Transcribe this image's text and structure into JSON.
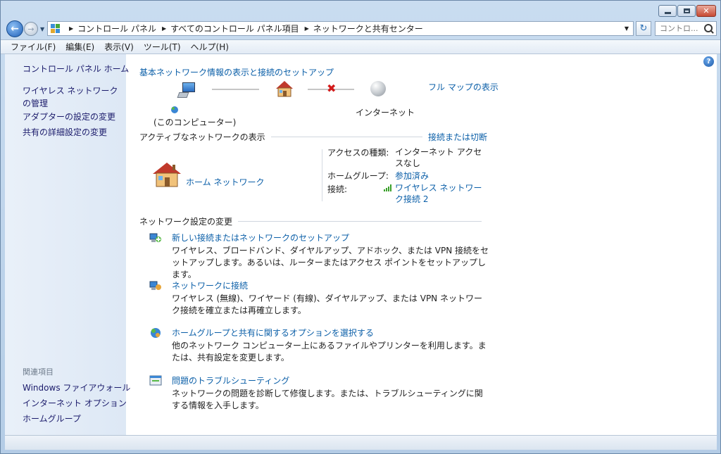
{
  "window": {
    "minimize_glyph": "",
    "close_glyph": "✕"
  },
  "address": {
    "crumbs": [
      "コントロール パネル",
      "すべてのコントロール パネル項目",
      "ネットワークと共有センター"
    ],
    "search_placeholder": "コントロ..."
  },
  "menu": [
    "ファイル(F)",
    "編集(E)",
    "表示(V)",
    "ツール(T)",
    "ヘルプ(H)"
  ],
  "sidebar": {
    "home": "コントロール パネル ホーム",
    "links": [
      "ワイヤレス ネットワークの管理",
      "アダプターの設定の変更",
      "共有の詳細設定の変更"
    ],
    "related_title": "関連項目",
    "related": [
      "Windows ファイアウォール",
      "インターネット オプション",
      "ホームグループ"
    ]
  },
  "main": {
    "title": "基本ネットワーク情報の表示と接続のセットアップ",
    "full_map": "フル マップの表示",
    "pc_label": "(このコンピューター)",
    "internet_label": "インターネット",
    "active_title": "アクティブなネットワークの表示",
    "connect_disconnect": "接続または切断",
    "network_name": "ホーム ネットワーク",
    "access_type_label": "アクセスの種類:",
    "access_type_value": "インターネット アクセスなし",
    "homegroup_label": "ホームグループ:",
    "homegroup_value": "参加済み",
    "connection_label": "接続:",
    "connection_value": "ワイヤレス ネットワーク接続 2",
    "settings_title": "ネットワーク設定の変更",
    "tasks": [
      {
        "link": "新しい接続またはネットワークのセットアップ",
        "desc": "ワイヤレス、ブロードバンド、ダイヤルアップ、アドホック、または VPN 接続をセットアップします。あるいは、ルーターまたはアクセス ポイントをセットアップします。"
      },
      {
        "link": "ネットワークに接続",
        "desc": "ワイヤレス (無線)、ワイヤード (有線)、ダイヤルアップ、または VPN ネットワーク接続を確立または再確立します。"
      },
      {
        "link": "ホームグループと共有に関するオプションを選択する",
        "desc": "他のネットワーク コンピューター上にあるファイルやプリンターを利用します。または、共有設定を変更します。"
      },
      {
        "link": "問題のトラブルシューティング",
        "desc": "ネットワークの問題を診断して修復します。または、トラブルシューティングに関する情報を入手します。"
      }
    ]
  },
  "icons": {
    "back": "back-arrow-icon",
    "forward": "forward-arrow-icon",
    "help": "help-icon"
  }
}
